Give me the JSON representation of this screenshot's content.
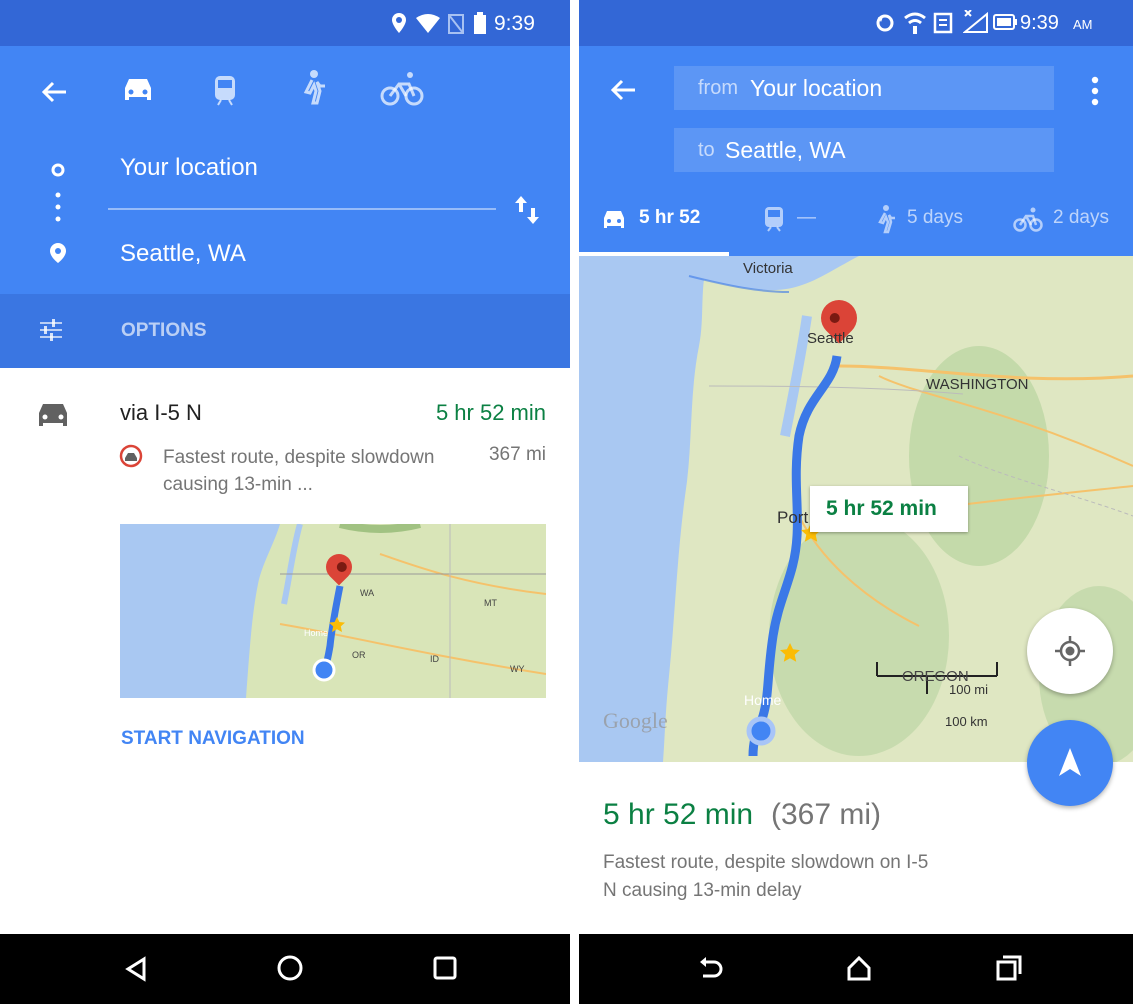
{
  "left": {
    "status": {
      "time": "9:39"
    },
    "modes": [
      "car-mode-tab",
      "transit-mode-tab",
      "walk-mode-tab",
      "bike-mode-tab"
    ],
    "from": "Your location",
    "to": "Seattle, WA",
    "options_label": "OPTIONS",
    "route": {
      "name": "via I-5 N",
      "duration": "5 hr 52 min",
      "desc": "Fastest route, despite slowdown causing 13-min ...",
      "distance": "367 mi"
    },
    "map_labels": {
      "wa": "WA",
      "mt": "MT",
      "or": "OR",
      "id": "ID",
      "wy": "WY",
      "home": "Home"
    },
    "start_nav": "START NAVIGATION"
  },
  "right": {
    "status": {
      "time": "9:39",
      "ampm": "AM"
    },
    "from_prefix": "from",
    "from_value": "Your location",
    "to_prefix": "to",
    "to_value": "Seattle, WA",
    "tabs": {
      "car": "5 hr 52",
      "transit": "—",
      "walk": "5 days",
      "bike": "2 days"
    },
    "map": {
      "victoria": "Victoria",
      "seattle": "Seattle",
      "washington": "WASHINGTON",
      "port": "Port",
      "oregon": "OREGON",
      "home": "Home",
      "route_time": "5 hr 52 min",
      "scale_mi": "100 mi",
      "scale_km": "100 km",
      "watermark": "Google"
    },
    "summary": {
      "time": "5 hr 52 min",
      "distance": "(367 mi)",
      "desc_line1": "Fastest route, despite slowdown on I-5",
      "desc_line2": "N causing 13-min delay"
    }
  },
  "colors": {
    "header_blue": "#4285f4",
    "status_blue": "#3367d6",
    "options_blue": "#3a76e2",
    "route_green": "#0b8043",
    "route_line": "#3b78e7",
    "pin_red": "#db4437"
  }
}
